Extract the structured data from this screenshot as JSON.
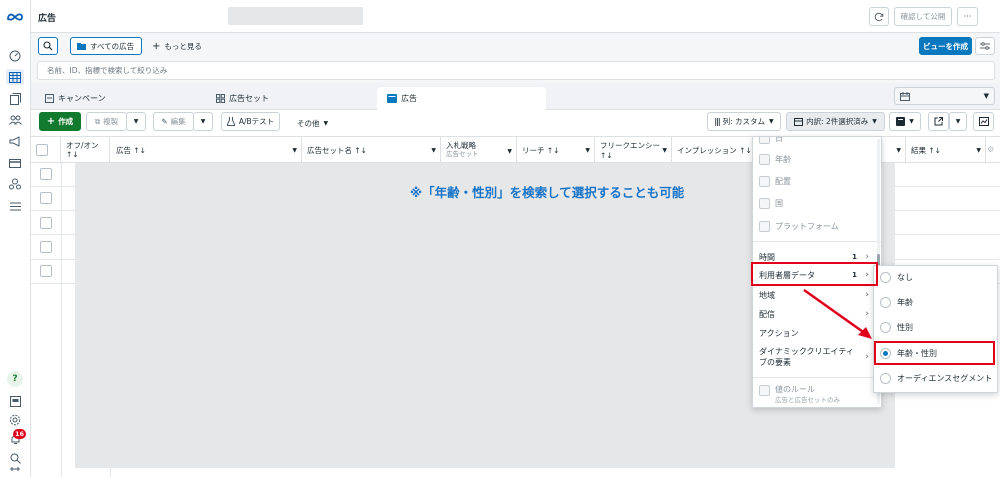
{
  "app": {
    "title": "広告"
  },
  "topbar": {
    "review_publish": "確認して公開",
    "more": "···"
  },
  "filterbar": {
    "all_ads": "すべての広告",
    "more": "もっと見る",
    "search_placeholder": "名前、ID、指標で検索して絞り込み",
    "create_view": "ビューを作成"
  },
  "tabs": [
    {
      "label": "キャンペーン"
    },
    {
      "label": "広告セット"
    },
    {
      "label": "広告"
    }
  ],
  "toolbar": {
    "create": "作成",
    "duplicate": "複製",
    "edit": "編集",
    "ab_test": "A/Bテスト",
    "other": "その他",
    "columns": "列: カスタム",
    "breakdown": "内訳: 2件選択済み"
  },
  "columns": {
    "onoff_line1": "オフ/オン",
    "onoff_line2": "↑↓",
    "ad": "広告 ↑↓",
    "adset": "広告セット名 ↑↓",
    "bid_line1": "入札戦略",
    "bid_line2": "広告セット",
    "reach": "リーチ ↑↓",
    "frequency": "フリークエンシー ↑↓",
    "impressions": "インプレッション ↑↓",
    "results": "結果 ↑↓"
  },
  "note": "※「年齢・性別」を検索して選択することも可能",
  "breakdown_panel": {
    "items_top": [
      "日",
      "年齢",
      "配置",
      "国",
      "プラットフォーム"
    ],
    "groups": [
      {
        "label": "時間",
        "count": "1"
      },
      {
        "label": "利用者層データ",
        "count": "1"
      },
      {
        "label": "地域",
        "count": ""
      },
      {
        "label": "配信",
        "count": ""
      },
      {
        "label": "アクション",
        "count": ""
      },
      {
        "label": "ダイナミッククリエイティブの要素",
        "count": ""
      }
    ],
    "rule_label": "値のルール",
    "rule_sub": "広告と広告セットのみ"
  },
  "demographics_options": [
    {
      "label": "なし",
      "selected": false
    },
    {
      "label": "年齢",
      "selected": false
    },
    {
      "label": "性別",
      "selected": false
    },
    {
      "label": "年齢・性別",
      "selected": true
    },
    {
      "label": "オーディエンスセグメント",
      "selected": false
    }
  ],
  "notifications": {
    "count": "16"
  },
  "colors": {
    "accent": "#0a78be",
    "create": "#117a2e",
    "highlight": "#e0001b",
    "note": "#1874c8"
  }
}
